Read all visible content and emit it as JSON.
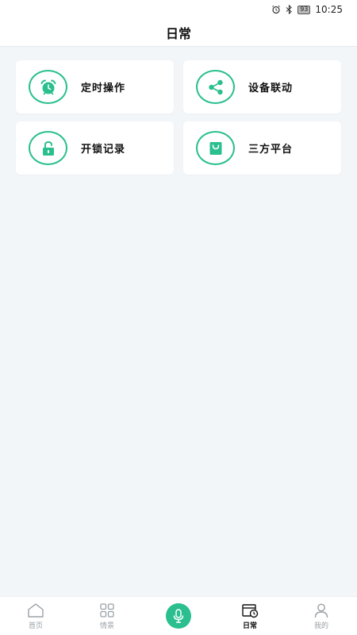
{
  "status_bar": {
    "battery": "93",
    "time": "10:25",
    "icons": [
      "alarm-icon",
      "bluetooth-icon",
      "battery-icon"
    ]
  },
  "header": {
    "title": "日常"
  },
  "cards": [
    {
      "label": "定时操作",
      "icon": "alarm-clock-icon"
    },
    {
      "label": "设备联动",
      "icon": "share-icon"
    },
    {
      "label": "开锁记录",
      "icon": "unlock-icon"
    },
    {
      "label": "三方平台",
      "icon": "shopping-bag-icon"
    }
  ],
  "tabbar": {
    "items": [
      {
        "label": "首页",
        "icon": "home-icon"
      },
      {
        "label": "情景",
        "icon": "grid-icon"
      },
      {
        "label": "",
        "icon": "microphone-icon"
      },
      {
        "label": "日常",
        "icon": "calendar-clock-icon",
        "active": true
      },
      {
        "label": "我的",
        "icon": "user-icon"
      }
    ]
  },
  "colors": {
    "accent": "#2bbf8f",
    "background": "#f3f6f9",
    "card": "#ffffff"
  }
}
